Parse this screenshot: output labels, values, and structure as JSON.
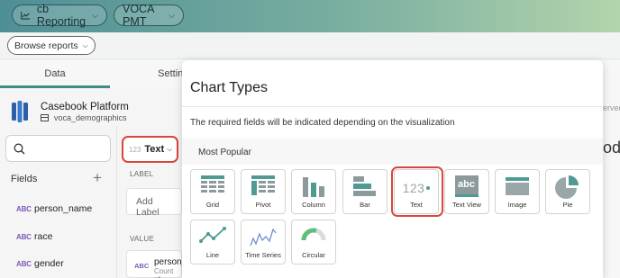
{
  "header": {
    "report_name": "cb Reporting",
    "project_name": "VOCA PMT",
    "browse_reports": "Browse reports"
  },
  "tabs": {
    "data": "Data",
    "settings": "Settings"
  },
  "dataset": {
    "name": "Casebook Platform",
    "table": "voca_demographics"
  },
  "fields_panel": {
    "title": "Fields",
    "items": [
      {
        "type": "ABC",
        "name": "person_name"
      },
      {
        "type": "ABC",
        "name": "race"
      },
      {
        "type": "ABC",
        "name": "gender"
      }
    ]
  },
  "viz": {
    "current_type_icon": "123",
    "current_type": "Text",
    "label_header": "LABEL",
    "add_label": "Add Label",
    "value_header": "VALUE",
    "value_type": "ABC",
    "value_field": "person_",
    "value_agg": "Count of"
  },
  "background_right": {
    "partial_text": "erved",
    "partial_title": "od"
  },
  "modal": {
    "title": "Chart Types",
    "description": "The required fields will be indicated depending on the visualization",
    "section": "Most Popular",
    "selected": "Text",
    "tiles": [
      {
        "label": "Grid",
        "icon": "grid-icon"
      },
      {
        "label": "Pivot",
        "icon": "pivot-icon"
      },
      {
        "label": "Column",
        "icon": "column-chart-icon"
      },
      {
        "label": "Bar",
        "icon": "bar-chart-icon"
      },
      {
        "label": "Text",
        "icon": "text-123-icon",
        "glyph": "123"
      },
      {
        "label": "Text View",
        "icon": "text-view-icon",
        "glyph": "abc"
      },
      {
        "label": "Image",
        "icon": "image-icon"
      },
      {
        "label": "Pie",
        "icon": "pie-chart-icon"
      },
      {
        "label": "Line",
        "icon": "line-chart-icon"
      },
      {
        "label": "Time Series",
        "icon": "time-series-icon"
      },
      {
        "label": "Circular",
        "icon": "circular-gauge-icon"
      }
    ]
  },
  "colors": {
    "accent": "#3f8c8a",
    "highlight": "#d9473c",
    "field_type": "#7b5ab8",
    "icon_gray": "#8c9a9d",
    "icon_teal": "#4f9b94"
  }
}
